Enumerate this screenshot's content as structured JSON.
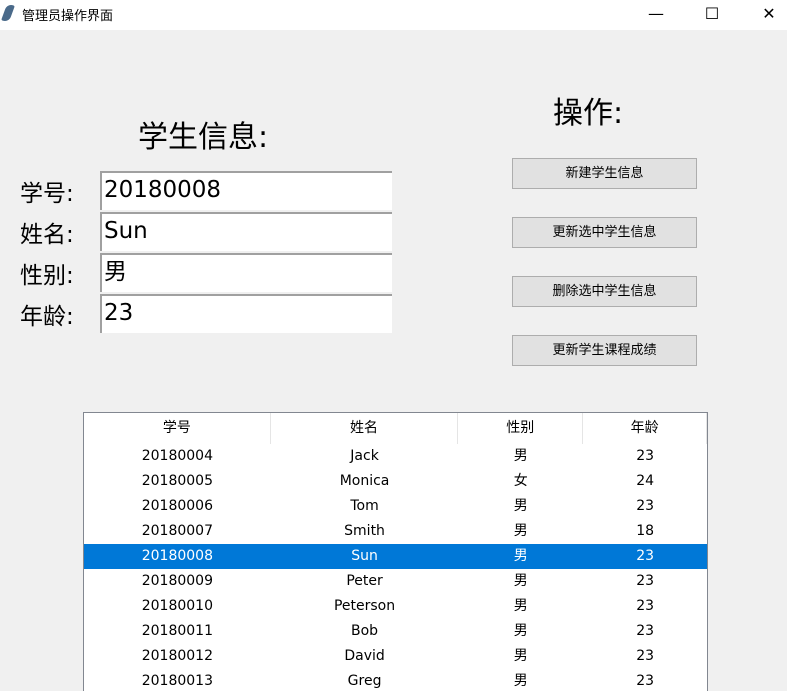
{
  "window": {
    "title": "管理员操作界面",
    "minimize": "—",
    "maximize": "☐",
    "close": "✕"
  },
  "form": {
    "title": "学生信息:",
    "fields": [
      {
        "label": "学号:",
        "value": "20180008"
      },
      {
        "label": "姓名:",
        "value": "Sun"
      },
      {
        "label": "性别:",
        "value": "男"
      },
      {
        "label": "年龄:",
        "value": "23"
      }
    ]
  },
  "actions": {
    "title": "操作:",
    "buttons": [
      "新建学生信息",
      "更新选中学生信息",
      "删除选中学生信息",
      "更新学生课程成绩"
    ]
  },
  "table": {
    "columns": [
      "学号",
      "姓名",
      "性别",
      "年龄"
    ],
    "selected_index": 4,
    "rows": [
      [
        "20180004",
        "Jack",
        "男",
        "23"
      ],
      [
        "20180005",
        "Monica",
        "女",
        "24"
      ],
      [
        "20180006",
        "Tom",
        "男",
        "23"
      ],
      [
        "20180007",
        "Smith",
        "男",
        "18"
      ],
      [
        "20180008",
        "Sun",
        "男",
        "23"
      ],
      [
        "20180009",
        "Peter",
        "男",
        "23"
      ],
      [
        "20180010",
        "Peterson",
        "男",
        "23"
      ],
      [
        "20180011",
        "Bob",
        "男",
        "23"
      ],
      [
        "20180012",
        "David",
        "男",
        "23"
      ],
      [
        "20180013",
        "Greg",
        "男",
        "23"
      ]
    ]
  }
}
